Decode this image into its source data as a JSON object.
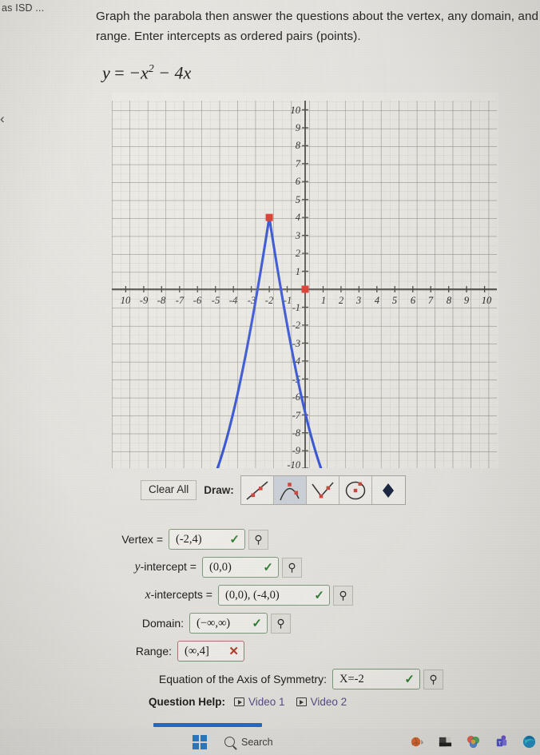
{
  "browser": {
    "tab_label": "as ISD ...",
    "back_chevron": "‹"
  },
  "prompt": {
    "text": "Graph the parabola then answer the questions about the vertex, any domain, and range. Enter intercepts as ordered pairs (points).",
    "equation_lhs": "y",
    "equation_eq": "=",
    "equation_rhs_a": "−x",
    "equation_exp": "2",
    "equation_rhs_b": "− 4x",
    "equation_plain": "y = −x² − 4x"
  },
  "chart_data": {
    "type": "line",
    "title": "",
    "xlabel": "",
    "ylabel": "",
    "xlim": [
      -10.4,
      10.4
    ],
    "ylim": [
      -10.4,
      10.4
    ],
    "grid": true,
    "minor_grid": true,
    "x_tick_labels": [
      "10",
      "-9",
      "-8",
      "-7",
      "-6",
      "-5",
      "-4",
      "-3",
      "-2",
      "-1",
      "1",
      "2",
      "3",
      "4",
      "5",
      "6",
      "7",
      "8",
      "9",
      "10"
    ],
    "y_tick_labels": [
      "10",
      "9",
      "8",
      "7",
      "6",
      "5",
      "4",
      "3",
      "2",
      "1",
      "-1",
      "-2",
      "-3",
      "-4",
      "-5",
      "-6",
      "-7",
      "-8",
      "-9",
      "-10"
    ],
    "curve_color": "#2f4fd4",
    "marker_color": "#e03127",
    "function": "y = -x^2 - 4x",
    "vertex": [
      -2,
      4
    ],
    "markers": [
      {
        "label": "vertex",
        "x": -2,
        "y": 4
      },
      {
        "label": "intercept",
        "x": 0,
        "y": 0
      }
    ],
    "series": [
      {
        "name": "y = -x^2 - 4x",
        "x": [
          -6.0,
          -5.6,
          -5.2,
          -4.8,
          -4.4,
          -4.0,
          -3.6,
          -3.2,
          -2.8,
          -2.4,
          -2.0,
          -1.6,
          -1.2,
          -0.8,
          -0.4,
          0.0,
          0.4,
          0.8,
          1.2,
          1.6,
          2.0
        ],
        "values": [
          -12.0,
          -8.96,
          -6.24,
          -3.84,
          -1.76,
          0.0,
          1.44,
          2.56,
          3.36,
          3.84,
          4.0,
          3.84,
          3.36,
          2.56,
          1.44,
          0.0,
          -1.76,
          -3.84,
          -6.24,
          -8.96,
          -12.0
        ]
      }
    ]
  },
  "toolbar": {
    "clear_all_label": "Clear All",
    "draw_label": "Draw:",
    "tools": [
      {
        "name": "line-tool",
        "selected": false
      },
      {
        "name": "parabola-tool",
        "selected": true
      },
      {
        "name": "absolute-value-tool",
        "selected": false
      },
      {
        "name": "circle-tool",
        "selected": false
      },
      {
        "name": "point-tool",
        "selected": false
      }
    ]
  },
  "answers": {
    "key_glyph": "⚲",
    "check_glyph": "✓",
    "cross_glyph": "✕",
    "rows": [
      {
        "label_pre": "Vertex",
        "label_it": "",
        "label_post": " =",
        "value": "(-2,4)",
        "status": "correct"
      },
      {
        "label_pre": "",
        "label_it": "y",
        "label_post": "-intercept =",
        "value": "(0,0)",
        "status": "correct"
      },
      {
        "label_pre": "",
        "label_it": "x",
        "label_post": "-intercepts =",
        "value": "(0,0), (-4,0)",
        "status": "correct"
      },
      {
        "label_pre": "Domain:",
        "label_it": "",
        "label_post": "",
        "value": "(−∞,∞)",
        "status": "correct"
      },
      {
        "label_pre": "Range:",
        "label_it": "",
        "label_post": "",
        "value": "(∞,4]",
        "status": "incorrect"
      },
      {
        "label_pre": "Equation of the Axis of Symmetry:",
        "label_it": "",
        "label_post": "",
        "value": "X=-2",
        "status": "correct"
      }
    ]
  },
  "question_help": {
    "title": "Question Help:",
    "links": [
      "Video 1",
      "Video 2"
    ]
  },
  "taskbar": {
    "search_placeholder": "Search"
  },
  "colors": {
    "curve": "#2f4fd4",
    "marker": "#e03127",
    "correct": "#2e7d32",
    "incorrect": "#c0392b",
    "link": "#5b4b8a",
    "accent_bar": "#1f6fd0"
  }
}
